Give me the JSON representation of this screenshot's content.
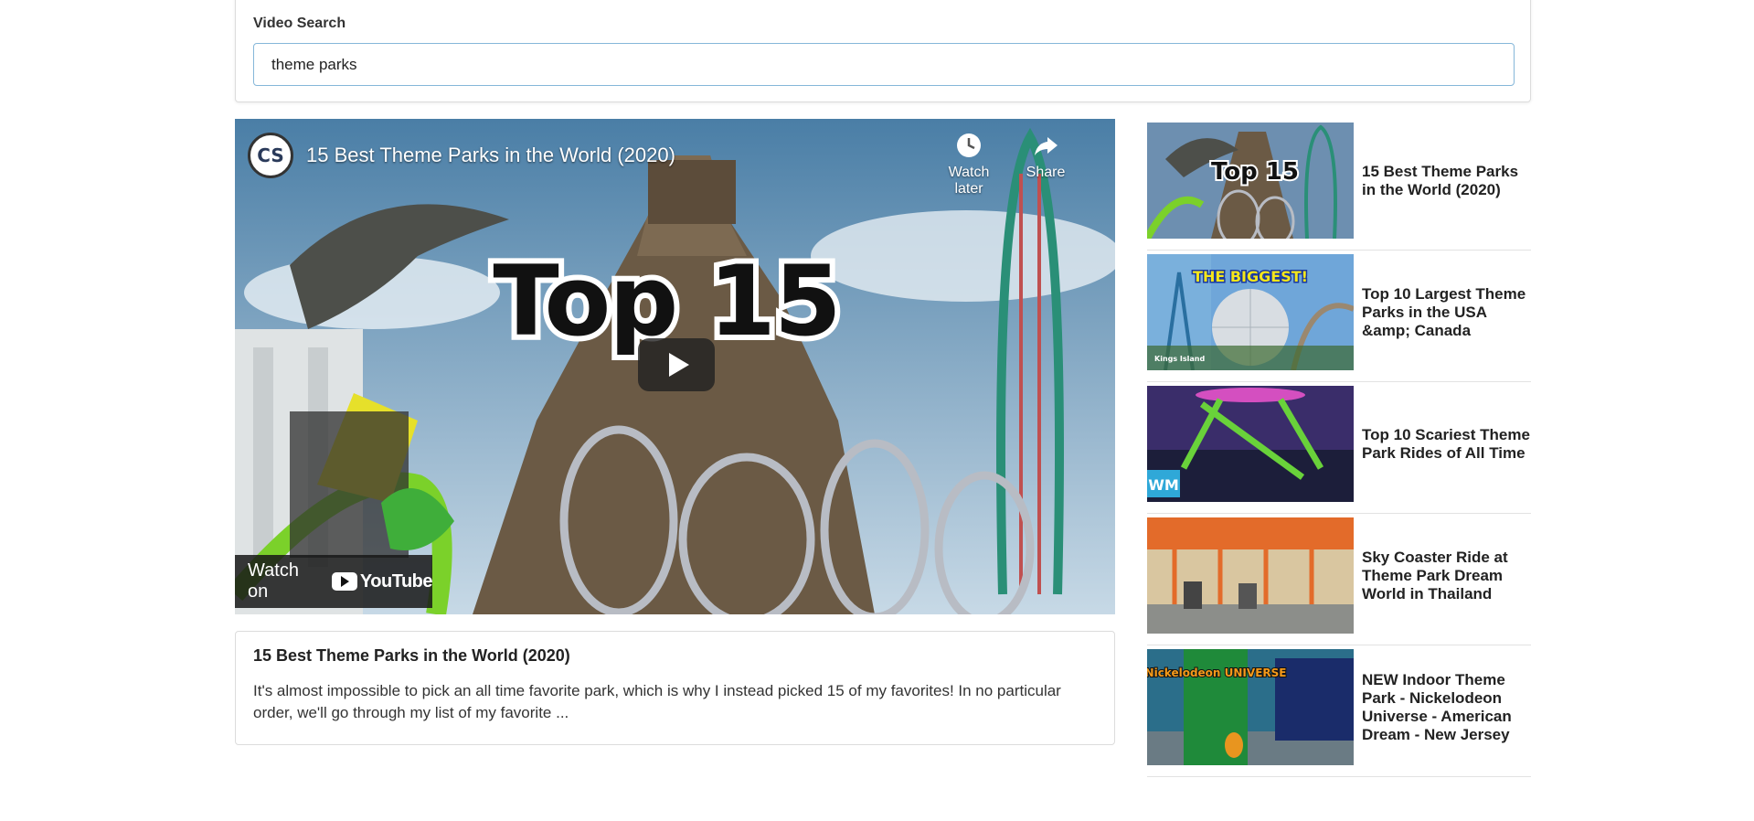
{
  "search": {
    "label": "Video Search",
    "value": "theme parks"
  },
  "player": {
    "channel_logo_text": "CS",
    "title": "15 Best Theme Parks in the World (2020)",
    "watch_later_label": "Watch later",
    "share_label": "Share",
    "watch_on_label": "Watch on",
    "youtube_label": "YouTube",
    "thumbnail_text": "Top 15"
  },
  "description": {
    "title": "15 Best Theme Parks in the World (2020)",
    "text": "It's almost impossible to pick an all time favorite park, which is why I instead picked 15 of my favorites! In no particular order, we'll go through my list of my favorite ..."
  },
  "video_list": [
    {
      "title": "15 Best Theme Parks in the World (2020)",
      "thumb_text": "Top 15"
    },
    {
      "title": "Top 10 Largest Theme Parks in the USA &amp; Canada",
      "thumb_text": "THE BIGGEST!",
      "thumb_subtext": "Kings Island"
    },
    {
      "title": "Top 10 Scariest Theme Park Rides of All Time",
      "thumb_text": "WM"
    },
    {
      "title": "Sky Coaster Ride at Theme Park Dream World in Thailand",
      "thumb_text": ""
    },
    {
      "title": "NEW Indoor Theme Park - Nickelodeon Universe - American Dream - New Jersey",
      "thumb_text": "Nickelodeon UNIVERSE"
    }
  ]
}
